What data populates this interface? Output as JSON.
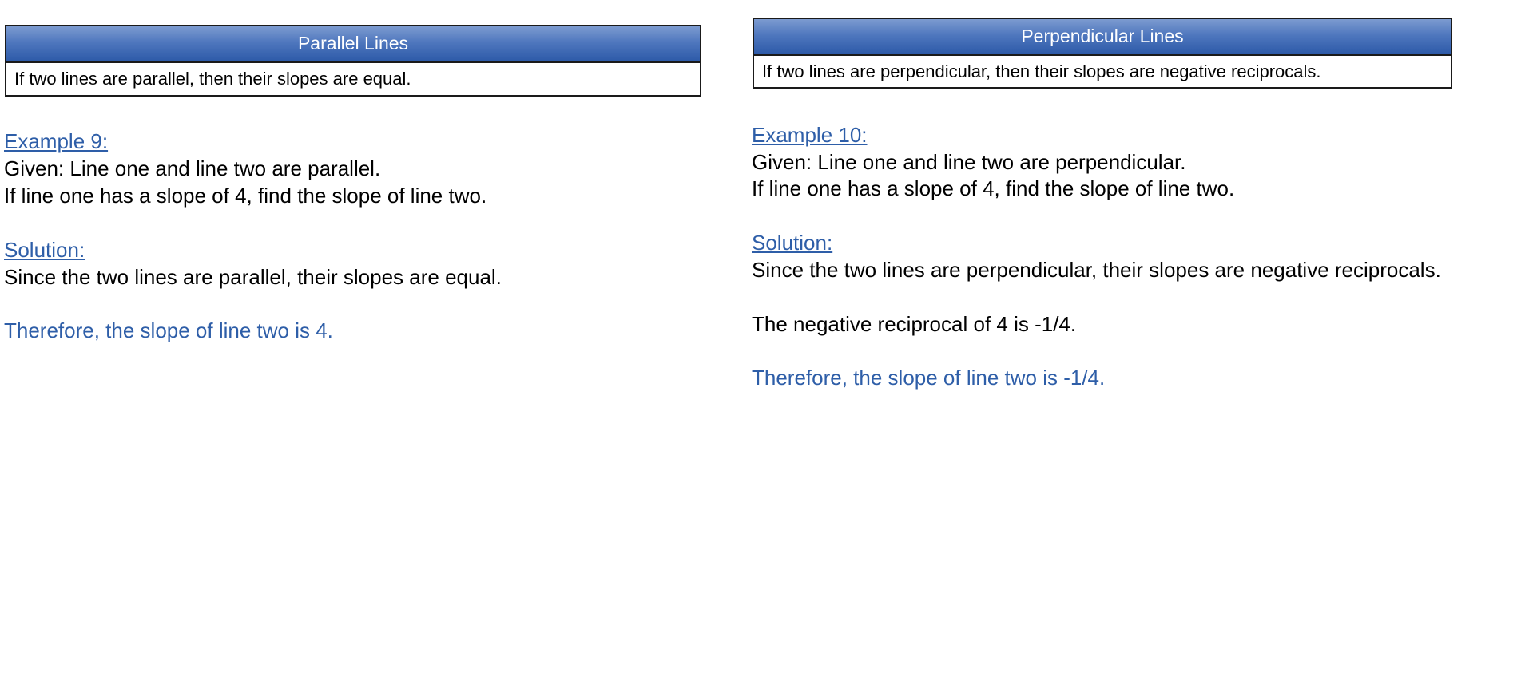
{
  "left": {
    "box": {
      "title": "Parallel Lines",
      "rule": "If two lines are parallel, then their slopes are equal."
    },
    "example_heading": "Example 9:",
    "given": "Given:  Line one and line two are parallel.",
    "question": "If line one has a slope of 4, find the slope of line two.",
    "solution_heading": "Solution:",
    "reasoning": "Since the two lines are parallel, their slopes are equal.",
    "conclusion": "Therefore, the slope of line two is 4."
  },
  "right": {
    "box": {
      "title": "Perpendicular Lines",
      "rule": "If two lines are perpendicular, then their slopes are negative reciprocals."
    },
    "example_heading": "Example 10:",
    "given": "Given:  Line one and line two are perpendicular.",
    "question": "If line one has a slope of 4, find the slope of line two.",
    "solution_heading": "Solution:",
    "reasoning": "Since the two lines are perpendicular, their slopes are negative reciprocals.",
    "step": "The negative reciprocal of 4 is -1/4.",
    "conclusion": "Therefore, the slope of line two is -1/4."
  },
  "colors": {
    "accent_blue": "#2e5ea8",
    "header_gradient_top": "#7c9bd0",
    "header_gradient_bottom": "#2d5aa8"
  }
}
